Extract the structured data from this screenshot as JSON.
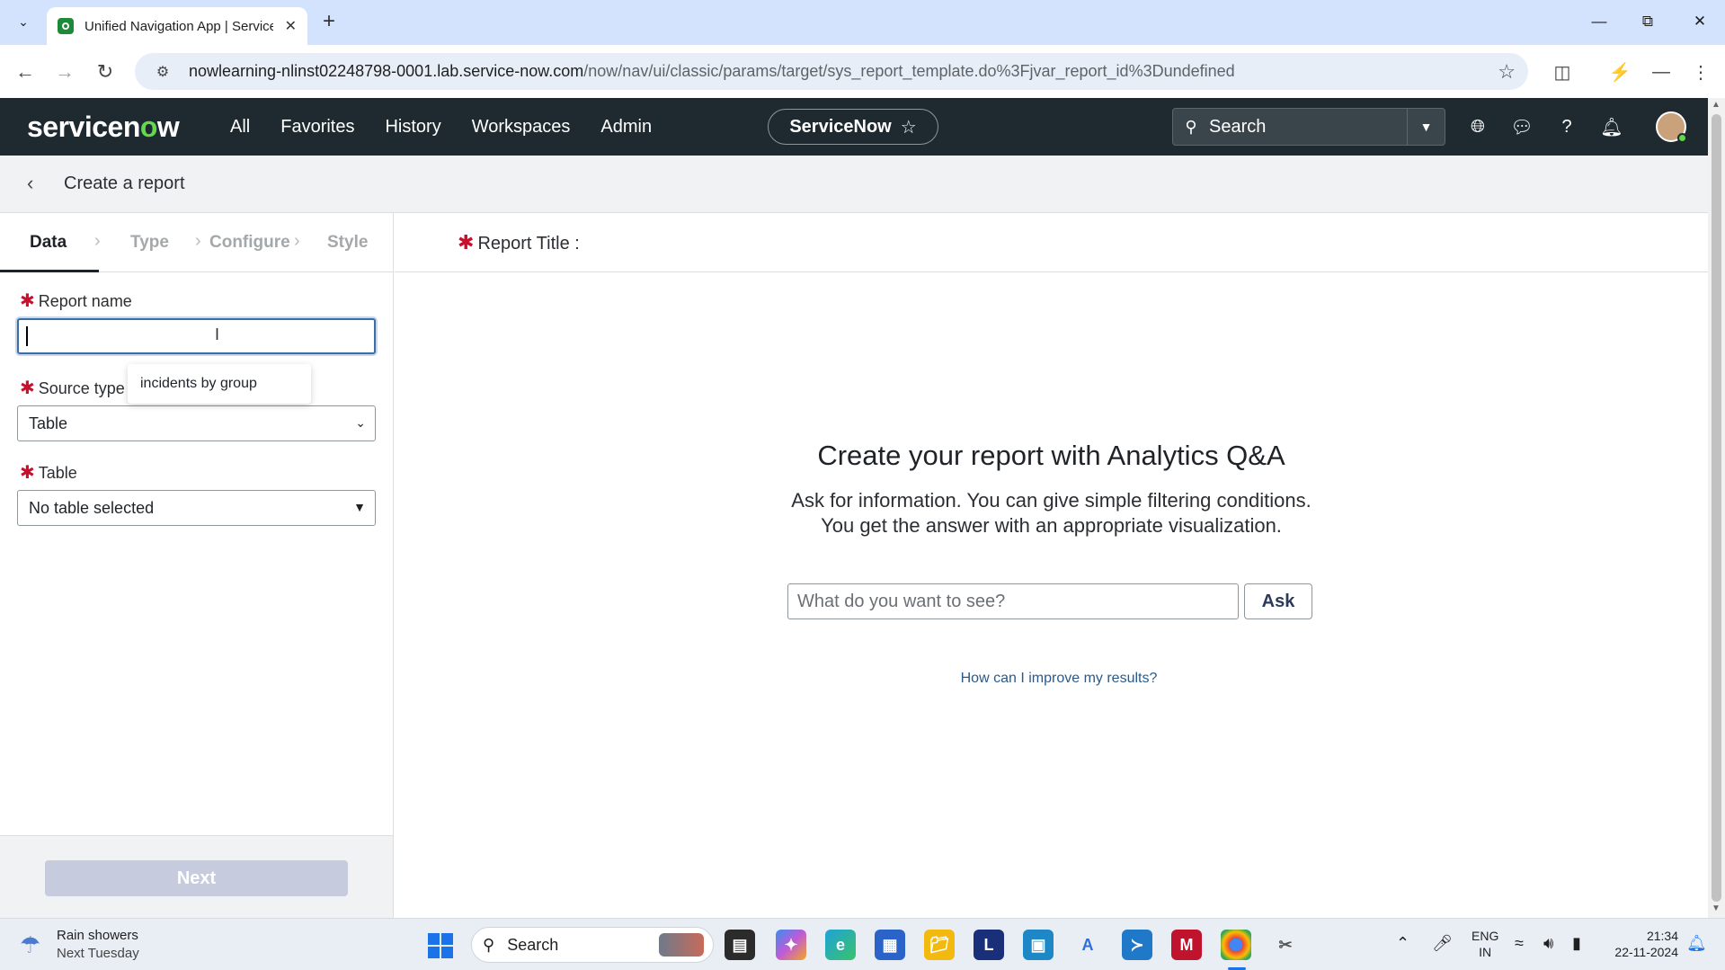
{
  "browser": {
    "tab_title": "Unified Navigation App | ServiceNow",
    "url_main": "nowlearning-nlinst02248798-0001.lab.service-now.com",
    "url_path": "/now/nav/ui/classic/params/target/sys_report_template.do%3Fjvar_report_id%3Dundefined"
  },
  "sn_header": {
    "logo_left": "servicen",
    "logo_o": "o",
    "logo_right": "w",
    "nav": [
      "All",
      "Favorites",
      "History",
      "Workspaces",
      "Admin"
    ],
    "scope": "ServiceNow",
    "search_placeholder": "Search"
  },
  "page": {
    "title": "Create a report",
    "steps": [
      "Data",
      "Type",
      "Configure",
      "Style"
    ],
    "report_name_label": "Report name",
    "autocomplete_suggestion": "incidents by group",
    "source_type_label": "Source type",
    "source_type_value": "Table",
    "table_label": "Table",
    "table_value": "No table selected",
    "next_button": "Next",
    "report_title_label": "Report Title :",
    "qa_heading": "Create your report with Analytics Q&A",
    "qa_sub_line1": "Ask for information. You can give simple filtering conditions.",
    "qa_sub_line2": "You get the answer with an appropriate visualization.",
    "qa_placeholder": "What do you want to see?",
    "ask_button": "Ask",
    "improve_link": "How can I improve my results?"
  },
  "taskbar": {
    "weather_title": "Rain showers",
    "weather_sub": "Next Tuesday",
    "search_label": "Search",
    "lang1": "ENG",
    "lang2": "IN",
    "time": "21:34",
    "date": "22-11-2024"
  },
  "colors": {
    "sn_header_bg": "#1e2a30",
    "logo_accent": "#62d84e",
    "required_star": "#c8102e",
    "link": "#2a5a8c"
  }
}
